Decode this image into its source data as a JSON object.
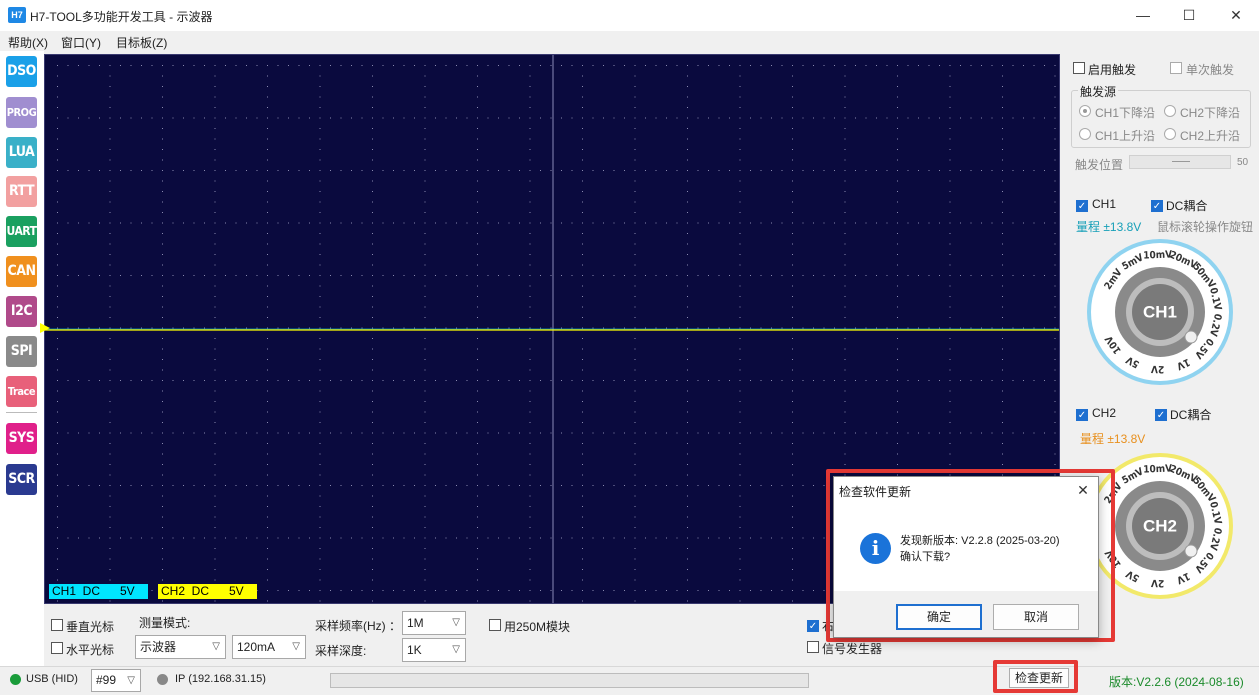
{
  "window": {
    "logo_text": "H7",
    "title": "H7-TOOL多功能开发工具 - 示波器",
    "min_glyph": "—",
    "max_glyph": "☐",
    "close_glyph": "✕"
  },
  "menu": [
    "帮助(X)",
    "窗口(Y)",
    "目标板(Z)"
  ],
  "tools": [
    {
      "label": "DSO",
      "color": "#1aa0e8"
    },
    {
      "label": "PROG",
      "color": "#a08ed0"
    },
    {
      "label": "LUA",
      "color": "#3ab0c8"
    },
    {
      "label": "RTT",
      "color": "#f2a0a0"
    },
    {
      "label": "UART",
      "color": "#1aa060"
    },
    {
      "label": "CAN",
      "color": "#f0901e"
    },
    {
      "label": "I2C",
      "color": "#b04a8a"
    },
    {
      "label": "SPI",
      "color": "#8a8a8a"
    },
    {
      "label": "Trace",
      "color": "#e8607a"
    },
    {
      "label": "SYS",
      "color": "#e0208a"
    },
    {
      "label": "SCR",
      "color": "#2a3a90"
    }
  ],
  "scope": {
    "ch1_label": "CH1  DC      5V",
    "ch2_label": "CH2  DC      5V",
    "ch1_color": "#00e5ff",
    "ch2_color": "#ffff00"
  },
  "bottom": {
    "vertical_cursor": "垂直光标",
    "horizontal_cursor": "水平光标",
    "measure_mode_label": "测量模式:",
    "measure_mode_value": "示波器",
    "current_range_value": "120mA",
    "sample_rate_label": "采样频率(Hz) ：",
    "sample_rate_value": "1M",
    "sample_depth_label": "采样深度:",
    "sample_depth_value": "1K",
    "use_250m": "用250M模块",
    "partial_label": "右",
    "signal_gen": "信号发生器"
  },
  "right": {
    "enable_trigger": "启用触发",
    "single_trigger": "单次触发",
    "trigger_source_title": "触发源",
    "ch1_falling": "CH1下降沿",
    "ch2_falling": "CH2下降沿",
    "ch1_rising": "CH1上升沿",
    "ch2_rising": "CH2上升沿",
    "trigger_pos_label": "触发位置",
    "trigger_pos_value": "50",
    "ch1": "CH1",
    "ch1_dc": "DC耦合",
    "ch1_range": "量程 ±13.8V",
    "knob_hint": "鼠标滚轮操作旋钮",
    "ch2": "CH2",
    "ch2_dc": "DC耦合",
    "ch2_range": "量程 ±13.8V",
    "knob1_center": "CH1",
    "knob2_center": "CH2",
    "knob_scale": [
      "2mV",
      "5mV",
      "10mV",
      "20mV",
      "50mV",
      "0.1V",
      "0.2V",
      "0.5V",
      "1V",
      "2V",
      "5V",
      "10V"
    ],
    "ch1_range_color": "#18a0b8",
    "ch2_range_color": "#e8901e"
  },
  "status": {
    "usb": "USB (HID)",
    "device": "#99",
    "ip": "IP (192.168.31.15)",
    "check_update": "检查更新",
    "version": "版本:V2.2.6 (2024-08-16)"
  },
  "dialog": {
    "title": "检查软件更新",
    "message_line1": "发现新版本: V2.2.8 (2025-03-20)",
    "message_line2": "确认下载?",
    "ok": "确定",
    "cancel": "取消",
    "info_glyph": "i"
  }
}
